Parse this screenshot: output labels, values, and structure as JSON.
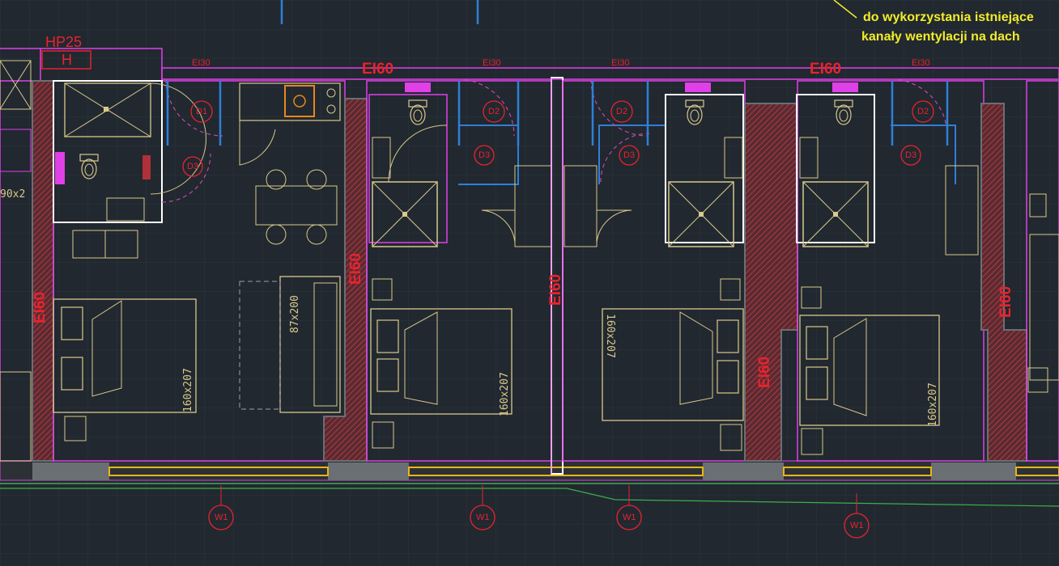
{
  "note": {
    "line1": "do wykorzystania istniejące",
    "line2": "kanały wentylacji na dach"
  },
  "fire_rating": {
    "ei60": "EI60",
    "ei30": "EI30"
  },
  "hydrant": {
    "code": "HP25",
    "letter": "H"
  },
  "doors": {
    "d1": "D1",
    "d2": "D2",
    "d3": "D3"
  },
  "windows": {
    "w1": "W1"
  },
  "beds": {
    "double": "160x207",
    "sofa": "87x200",
    "partial": "90x2"
  },
  "colors": {
    "background": "#212830",
    "wall_outline": "#e040e8",
    "wall_fill": "#6a6f74",
    "fire_wall_hatch": "#b0303a",
    "furniture": "#d9c98a",
    "red_annotation": "#e8232e",
    "yellow_note": "#f2ec2a",
    "door_blue": "#2f7fd8",
    "window_green": "#3fae4a"
  }
}
